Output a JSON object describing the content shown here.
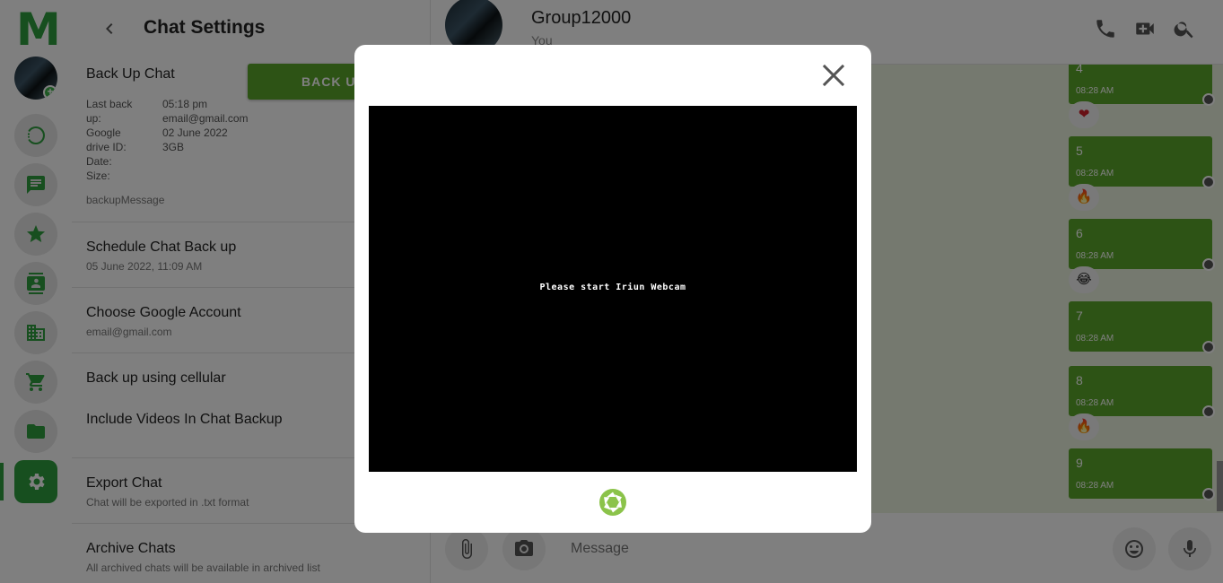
{
  "app": {
    "logo": "M"
  },
  "rail": {
    "items": [
      {
        "name": "status",
        "icon": "status-ring-icon"
      },
      {
        "name": "chats",
        "icon": "chat-bubble-icon"
      },
      {
        "name": "starred",
        "icon": "star-icon"
      },
      {
        "name": "contacts",
        "icon": "contact-book-icon"
      },
      {
        "name": "business",
        "icon": "building-icon"
      },
      {
        "name": "shop",
        "icon": "cart-icon"
      },
      {
        "name": "files",
        "icon": "folder-icon"
      },
      {
        "name": "settings",
        "icon": "gear-icon",
        "active": true
      }
    ]
  },
  "settings": {
    "title": "Chat Settings",
    "backup": {
      "title": "Back Up Chat",
      "button_label": "BACK UP",
      "labels": [
        "Last back",
        "up:",
        "Google",
        "drive ID:",
        "Date:",
        "Size:"
      ],
      "values": [
        "05:18 pm",
        "email@gmail.com",
        "02 June 2022",
        "3GB"
      ],
      "message": "backupMessage"
    },
    "rows": {
      "schedule": {
        "title": "Schedule Chat Back up",
        "subtitle": "05 June 2022, 11:09 AM"
      },
      "account": {
        "title": "Choose Google Account",
        "subtitle": "email@gmail.com"
      },
      "cellular": {
        "title": "Back up using cellular"
      },
      "videos": {
        "title": "Include Videos In Chat Backup"
      },
      "export": {
        "title": "Export Chat",
        "subtitle": "Chat will be exported in .txt format"
      },
      "archive": {
        "title": "Archive Chats",
        "subtitle": "All archived chats will be available in archived list"
      }
    }
  },
  "chat": {
    "name": "Group12000",
    "subtitle": "You",
    "messages": [
      {
        "text": "4",
        "time": "08:28 AM",
        "reaction": "❤"
      },
      {
        "text": "5",
        "time": "08:28 AM",
        "reaction": "🔥"
      },
      {
        "text": "6",
        "time": "08:28 AM",
        "reaction": "😂"
      },
      {
        "text": "7",
        "time": "08:28 AM",
        "reaction": ""
      },
      {
        "text": "8",
        "time": "08:28 AM",
        "reaction": "🔥"
      },
      {
        "text": "9",
        "time": "08:28 AM",
        "reaction": ""
      }
    ],
    "composer": {
      "placeholder": "Message"
    }
  },
  "modal": {
    "video_message": "Please start Iriun Webcam"
  },
  "colors": {
    "accent": "#2e9e3e",
    "bubble": "#5aa62b",
    "chat_bg": "#eaf3df"
  }
}
